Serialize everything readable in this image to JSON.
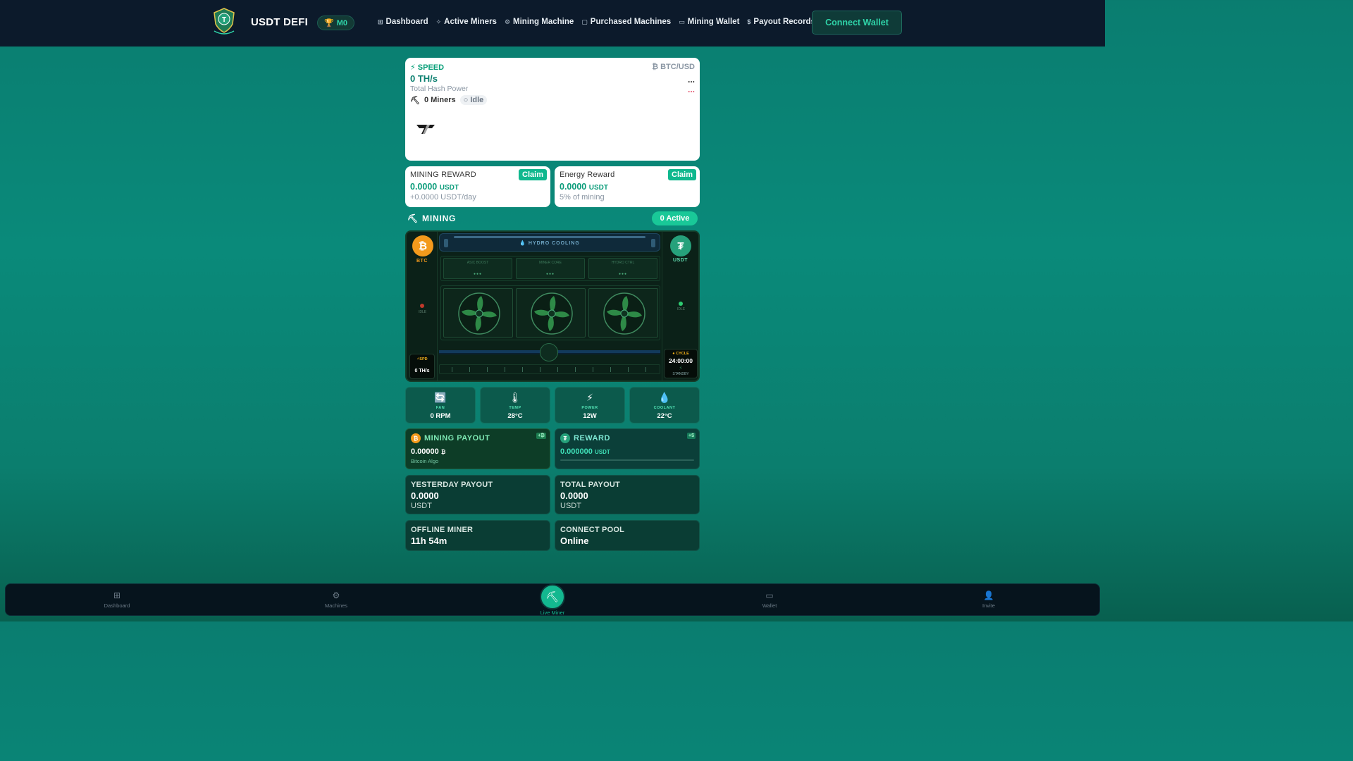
{
  "header": {
    "brand": "USDT DEFI",
    "rank_badge": "M0",
    "nav": [
      {
        "icon": "grid-icon",
        "glyph": "⊞",
        "label": "Dashboard"
      },
      {
        "icon": "sparkle-icon",
        "glyph": "✧",
        "label": "Active Miners"
      },
      {
        "icon": "cpu-icon",
        "glyph": "⚙",
        "label": "Mining Machine"
      },
      {
        "icon": "bag-icon",
        "glyph": "▢",
        "label": "Purchased Machines"
      },
      {
        "icon": "wallet-icon",
        "glyph": "▭",
        "label": "Mining Wallet"
      },
      {
        "icon": "dollar-icon",
        "glyph": "$",
        "label": "Payout Records"
      }
    ],
    "connect_label": "Connect Wallet"
  },
  "speed": {
    "label": "SPEED",
    "pair": "BTC/USD",
    "value": "0 TH/s",
    "sub": "Total Hash Power",
    "dots_primary": "...",
    "dots_secondary": "...",
    "miners": "0 Miners",
    "status": "Idle"
  },
  "rewards": {
    "mining": {
      "title": "MINING REWARD",
      "claim": "Claim",
      "value": "0.0000",
      "unit": "USDT",
      "sub": "+0.0000 USDT/day"
    },
    "energy": {
      "title": "Energy Reward",
      "claim": "Claim",
      "value": "0.0000",
      "unit": "USDT",
      "sub": "5% of mining"
    }
  },
  "mining_section": {
    "title": "MINING",
    "active": "0 Active"
  },
  "machine": {
    "btc_label": "BTC",
    "usdt_label": "USDT",
    "hydro": "HYDRO COOLING",
    "modules": [
      {
        "title": "ASIC BOOST"
      },
      {
        "title": "MINER CORE"
      },
      {
        "title": "HYDRO CTRL"
      }
    ],
    "spd_label": "SPD",
    "spd_value": "0 TH/s",
    "cycle_label": "CYCLE",
    "cycle_time": "24:00:00",
    "cycle_state": "STANDBY"
  },
  "stats": [
    {
      "icon": "fan-icon",
      "glyph": "🔄",
      "label": "FAN",
      "value": "0 RPM"
    },
    {
      "icon": "thermometer-icon",
      "glyph": "🌡",
      "label": "TEMP",
      "value": "28°C"
    },
    {
      "icon": "bolt-icon",
      "glyph": "⚡",
      "label": "POWER",
      "value": "12W"
    },
    {
      "icon": "droplet-icon",
      "glyph": "💧",
      "label": "COOLANT",
      "value": "22°C"
    }
  ],
  "payout": {
    "mining": {
      "title": "MINING PAYOUT",
      "value": "0.00000",
      "unit": "₿",
      "sub": "Bitcoin Algo",
      "tag": "+₿"
    },
    "reward": {
      "title": "REWARD",
      "value": "0.000000",
      "unit": "USDT",
      "tag": "+$"
    }
  },
  "summary": {
    "yesterday": {
      "title": "YESTERDAY PAYOUT",
      "value": "0.0000",
      "unit": "USDT"
    },
    "total": {
      "title": "TOTAL PAYOUT",
      "value": "0.0000",
      "unit": "USDT"
    },
    "offline": {
      "title": "OFFLINE MINER",
      "value": "11h 54m"
    },
    "pool": {
      "title": "CONNECT POOL",
      "value": "Online"
    }
  },
  "bottom_nav": [
    {
      "icon": "grid-icon",
      "label": "Dashboard"
    },
    {
      "icon": "chip-icon",
      "label": "Machines"
    },
    {
      "icon": "pickaxe-icon",
      "label": "Live Miner"
    },
    {
      "icon": "wallet-icon",
      "label": "Wallet"
    },
    {
      "icon": "users-icon",
      "label": "Invite"
    }
  ],
  "colors": {
    "accent": "#10b88e",
    "btc": "#f39a1c",
    "usdt": "#26a17b",
    "header": "#0c1a2b"
  }
}
